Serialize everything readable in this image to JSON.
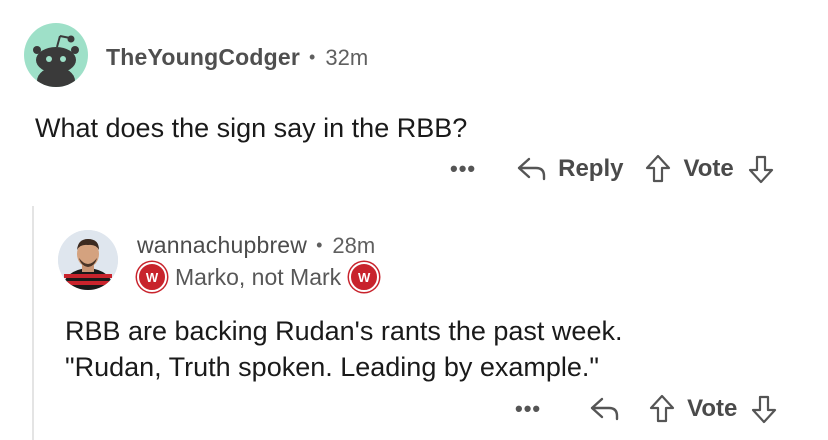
{
  "comment": {
    "author": "TheYoungCodger",
    "separator": "•",
    "time": "32m",
    "text": "What does the sign say in the RBB?",
    "actions": {
      "more": "•••",
      "reply": "Reply",
      "vote": "Vote"
    }
  },
  "reply": {
    "author": "wannachupbrew",
    "separator": "•",
    "time": "28m",
    "flair": "Marko, not Mark",
    "text_lines": [
      "RBB are backing Rudan's rants the past week.",
      "\"Rudan, Truth spoken. Leading by example.\""
    ],
    "actions": {
      "more": "•••",
      "vote": "Vote"
    }
  },
  "icons": {
    "avatar_top": "snoo-avatar-icon",
    "avatar_reply": "user-photo-avatar",
    "reply": "reply-arrow-icon",
    "upvote": "upvote-arrow-icon",
    "downvote": "downvote-arrow-icon",
    "flair_badge": "club-badge-icon"
  },
  "colors": {
    "avatar_bg": "#9ee0c8",
    "badge_red": "#c8232c",
    "thread_line": "#e4e4e4"
  }
}
